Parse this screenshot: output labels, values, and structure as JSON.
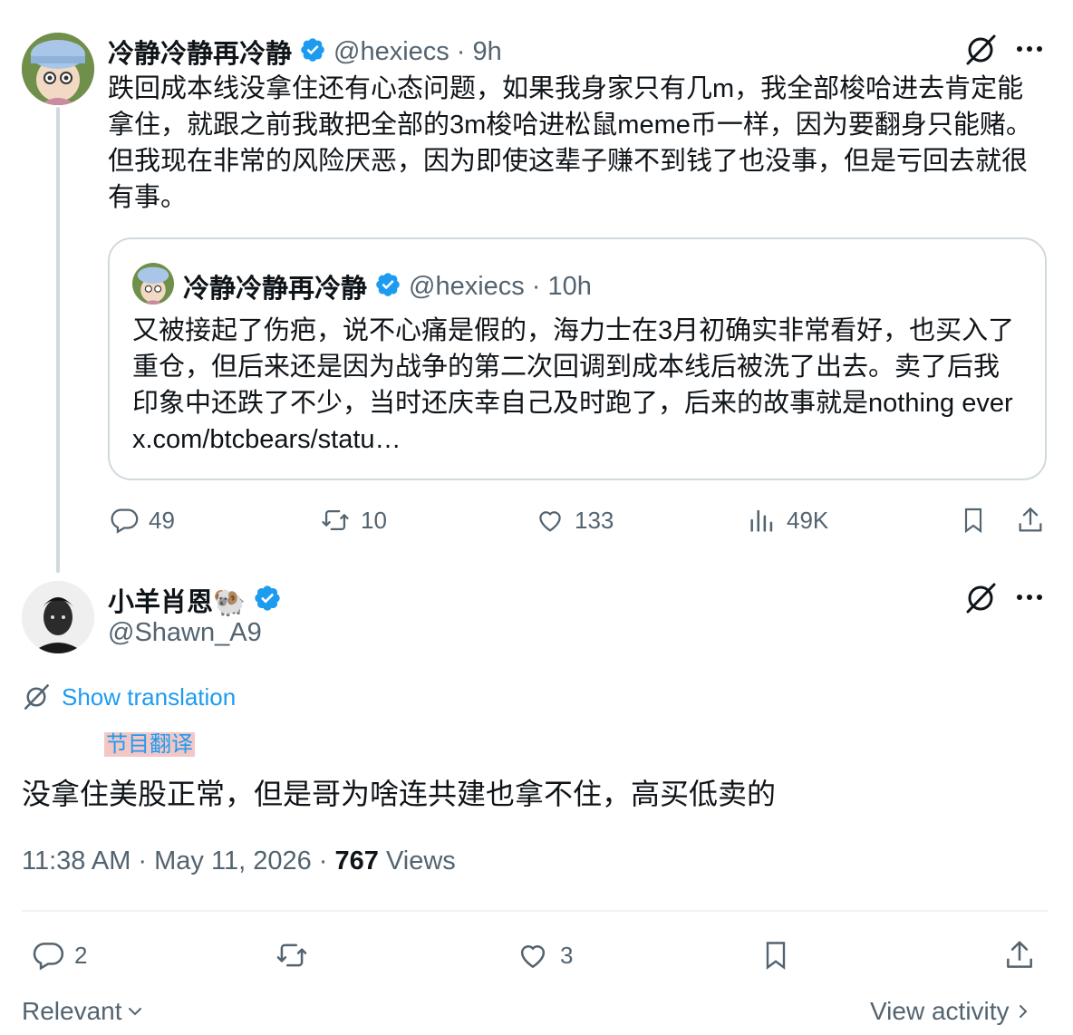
{
  "parent_tweet": {
    "author_name": "冷静冷静再冷静",
    "handle": "@hexiecs",
    "time": "· 9h",
    "text": "跌回成本线没拿住还有心态问题，如果我身家只有几m，我全部梭哈进去肯定能拿住，就跟之前我敢把全部的3m梭哈进松鼠meme币一样，因为要翻身只能赌。但我现在非常的风险厌恶，因为即使这辈子赚不到钱了也没事，但是亏回去就很有事。",
    "quote": {
      "author_name": "冷静冷静再冷静",
      "handle": "@hexiecs",
      "time": "· 10h",
      "text": "又被接起了伤疤，说不心痛是假的，海力士在3月初确实非常看好，也买入了重仓，但后来还是因为战争的第二次回调到成本线后被洗了出去。卖了后我印象中还跌了不少，当时还庆幸自己及时跑了，后来的故事就是nothing ever x.com/btcbears/statu…"
    },
    "actions": {
      "replies": "49",
      "reposts": "10",
      "likes": "133",
      "views": "49K"
    }
  },
  "main_tweet": {
    "author_name": "小羊肖恩🐏",
    "handle": "@Shawn_A9",
    "show_translation": "Show translation",
    "translation_note": "节目翻译",
    "text": "没拿住美股正常，但是哥为啥连共建也拿不住，高买低卖的",
    "timestamp": "11:38 AM · May 11, 2026 · ",
    "views_count": "767",
    "views_label": " Views",
    "actions": {
      "replies": "2",
      "likes": "3"
    }
  },
  "footer": {
    "sort_label": "Relevant",
    "view_activity": "View activity"
  },
  "colors": {
    "accent": "#1d9bf0",
    "text": "#0f1419",
    "secondary": "#536471",
    "border": "#cfd9de"
  },
  "icons": [
    "verified-badge-icon",
    "grok-translate-icon",
    "more-icon",
    "reply-icon",
    "repost-icon",
    "like-icon",
    "views-icon",
    "bookmark-icon",
    "share-icon",
    "chevron-down-icon",
    "chevron-right-icon"
  ]
}
